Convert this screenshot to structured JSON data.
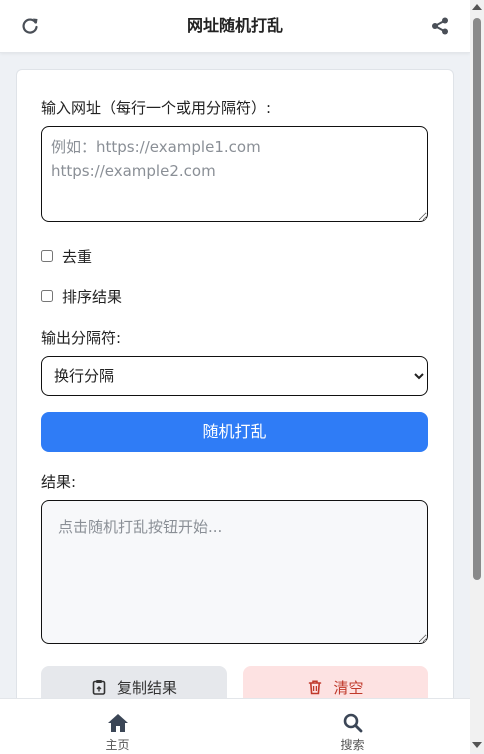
{
  "header": {
    "title": "网址随机打乱",
    "refresh_icon": "refresh-icon",
    "share_icon": "share-icon"
  },
  "form": {
    "input_label": "输入网址（每行一个或用分隔符）:",
    "input_placeholder": "例如：https://example1.com\nhttps://example2.com",
    "input_value": "",
    "dedupe_label": "去重",
    "dedupe_checked": false,
    "sort_label": "排序结果",
    "sort_checked": false,
    "separator_label": "输出分隔符:",
    "separator_selected": "换行分隔",
    "shuffle_label": "随机打乱",
    "result_label": "结果:",
    "result_placeholder": "点击随机打乱按钮开始...",
    "copy_label": "复制结果",
    "clear_label": "清空"
  },
  "nav": {
    "home_label": "主页",
    "search_label": "搜索"
  },
  "colors": {
    "primary": "#2f7cf6",
    "danger_bg": "#fde2e2",
    "danger_text": "#c0392b",
    "secondary_bg": "#e6e8ec"
  }
}
